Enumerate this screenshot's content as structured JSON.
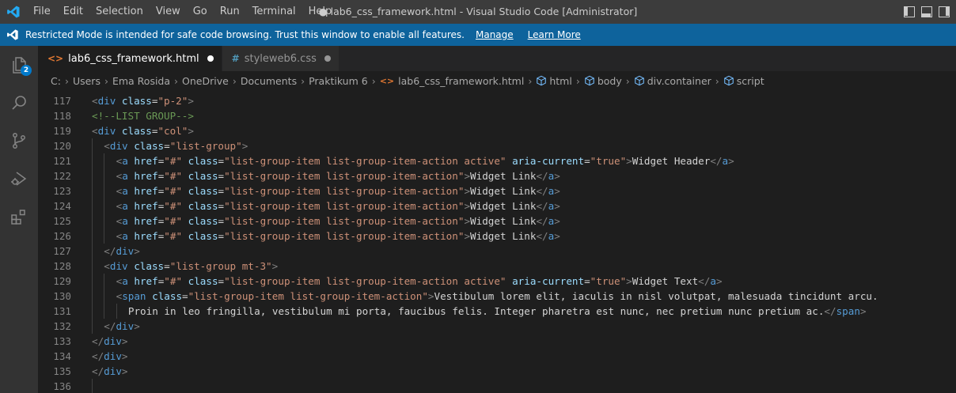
{
  "app": {
    "menu": [
      "File",
      "Edit",
      "Selection",
      "View",
      "Go",
      "Run",
      "Terminal",
      "Help"
    ],
    "window_title": "● lab6_css_framework.html - Visual Studio Code [Administrator]",
    "accent": "#007acc"
  },
  "banner": {
    "message": "Restricted Mode is intended for safe code browsing. Trust this window to enable all features.",
    "manage": "Manage",
    "learn_more": "Learn More",
    "color": "#0e639c"
  },
  "activity": {
    "explorer_badge": "2",
    "icons": [
      "files-icon",
      "search-icon",
      "source-control-icon",
      "run-debug-icon",
      "extensions-icon"
    ]
  },
  "tabs": [
    {
      "label": "lab6_css_framework.html",
      "icon": "<>",
      "active": true
    },
    {
      "label": "styleweb6.css",
      "icon": "#",
      "active": false
    }
  ],
  "breadcrumb": [
    "C:",
    "Users",
    "Ema Rosida",
    "OneDrive",
    "Documents",
    "Praktikum 6",
    "lab6_css_framework.html",
    "html",
    "body",
    "div.container",
    "script"
  ],
  "editor": {
    "lines": [
      {
        "n": "117",
        "indent": 0,
        "tokens": [
          [
            "t",
            "<"
          ],
          [
            "tg",
            "div"
          ],
          [
            "at",
            " class"
          ],
          [
            "tx",
            "="
          ],
          [
            "st",
            "\"p-2\""
          ],
          [
            "t",
            ">"
          ]
        ]
      },
      {
        "n": "118",
        "indent": 0,
        "tokens": [
          [
            "cm",
            "<!--LIST GROUP-->"
          ]
        ]
      },
      {
        "n": "119",
        "indent": 0,
        "tokens": [
          [
            "t",
            "<"
          ],
          [
            "tg",
            "div"
          ],
          [
            "at",
            " class"
          ],
          [
            "tx",
            "="
          ],
          [
            "st",
            "\"col\""
          ],
          [
            "t",
            ">"
          ]
        ]
      },
      {
        "n": "120",
        "indent": 1,
        "tokens": [
          [
            "t",
            "<"
          ],
          [
            "tg",
            "div"
          ],
          [
            "at",
            " class"
          ],
          [
            "tx",
            "="
          ],
          [
            "st",
            "\"list-group\""
          ],
          [
            "t",
            ">"
          ]
        ]
      },
      {
        "n": "121",
        "indent": 2,
        "tokens": [
          [
            "t",
            "<"
          ],
          [
            "tg",
            "a"
          ],
          [
            "at",
            " href"
          ],
          [
            "tx",
            "="
          ],
          [
            "st",
            "\"#\""
          ],
          [
            "at",
            " class"
          ],
          [
            "tx",
            "="
          ],
          [
            "st",
            "\"list-group-item list-group-item-action active\""
          ],
          [
            "at",
            " aria-current"
          ],
          [
            "tx",
            "="
          ],
          [
            "st",
            "\"true\""
          ],
          [
            "t",
            ">"
          ],
          [
            "tx",
            "Widget Header"
          ],
          [
            "t",
            "</"
          ],
          [
            "tg",
            "a"
          ],
          [
            "t",
            ">"
          ]
        ]
      },
      {
        "n": "122",
        "indent": 2,
        "tokens": [
          [
            "t",
            "<"
          ],
          [
            "tg",
            "a"
          ],
          [
            "at",
            " href"
          ],
          [
            "tx",
            "="
          ],
          [
            "st",
            "\"#\""
          ],
          [
            "at",
            " class"
          ],
          [
            "tx",
            "="
          ],
          [
            "st",
            "\"list-group-item list-group-item-action\""
          ],
          [
            "t",
            ">"
          ],
          [
            "tx",
            "Widget Link"
          ],
          [
            "t",
            "</"
          ],
          [
            "tg",
            "a"
          ],
          [
            "t",
            ">"
          ]
        ]
      },
      {
        "n": "123",
        "indent": 2,
        "tokens": [
          [
            "t",
            "<"
          ],
          [
            "tg",
            "a"
          ],
          [
            "at",
            " href"
          ],
          [
            "tx",
            "="
          ],
          [
            "st",
            "\"#\""
          ],
          [
            "at",
            " class"
          ],
          [
            "tx",
            "="
          ],
          [
            "st",
            "\"list-group-item list-group-item-action\""
          ],
          [
            "t",
            ">"
          ],
          [
            "tx",
            "Widget Link"
          ],
          [
            "t",
            "</"
          ],
          [
            "tg",
            "a"
          ],
          [
            "t",
            ">"
          ]
        ]
      },
      {
        "n": "124",
        "indent": 2,
        "tokens": [
          [
            "t",
            "<"
          ],
          [
            "tg",
            "a"
          ],
          [
            "at",
            " href"
          ],
          [
            "tx",
            "="
          ],
          [
            "st",
            "\"#\""
          ],
          [
            "at",
            " class"
          ],
          [
            "tx",
            "="
          ],
          [
            "st",
            "\"list-group-item list-group-item-action\""
          ],
          [
            "t",
            ">"
          ],
          [
            "tx",
            "Widget Link"
          ],
          [
            "t",
            "</"
          ],
          [
            "tg",
            "a"
          ],
          [
            "t",
            ">"
          ]
        ]
      },
      {
        "n": "125",
        "indent": 2,
        "tokens": [
          [
            "t",
            "<"
          ],
          [
            "tg",
            "a"
          ],
          [
            "at",
            " href"
          ],
          [
            "tx",
            "="
          ],
          [
            "st",
            "\"#\""
          ],
          [
            "at",
            " class"
          ],
          [
            "tx",
            "="
          ],
          [
            "st",
            "\"list-group-item list-group-item-action\""
          ],
          [
            "t",
            ">"
          ],
          [
            "tx",
            "Widget Link"
          ],
          [
            "t",
            "</"
          ],
          [
            "tg",
            "a"
          ],
          [
            "t",
            ">"
          ]
        ]
      },
      {
        "n": "126",
        "indent": 2,
        "tokens": [
          [
            "t",
            "<"
          ],
          [
            "tg",
            "a"
          ],
          [
            "at",
            " href"
          ],
          [
            "tx",
            "="
          ],
          [
            "st",
            "\"#\""
          ],
          [
            "at",
            " class"
          ],
          [
            "tx",
            "="
          ],
          [
            "st",
            "\"list-group-item list-group-item-action\""
          ],
          [
            "t",
            ">"
          ],
          [
            "tx",
            "Widget Link"
          ],
          [
            "t",
            "</"
          ],
          [
            "tg",
            "a"
          ],
          [
            "t",
            ">"
          ]
        ]
      },
      {
        "n": "127",
        "indent": 1,
        "tokens": [
          [
            "t",
            "</"
          ],
          [
            "tg",
            "div"
          ],
          [
            "t",
            ">"
          ]
        ]
      },
      {
        "n": "128",
        "indent": 1,
        "tokens": [
          [
            "t",
            "<"
          ],
          [
            "tg",
            "div"
          ],
          [
            "at",
            " class"
          ],
          [
            "tx",
            "="
          ],
          [
            "st",
            "\"list-group mt-3\""
          ],
          [
            "t",
            ">"
          ]
        ]
      },
      {
        "n": "129",
        "indent": 2,
        "tokens": [
          [
            "t",
            "<"
          ],
          [
            "tg",
            "a"
          ],
          [
            "at",
            " href"
          ],
          [
            "tx",
            "="
          ],
          [
            "st",
            "\"#\""
          ],
          [
            "at",
            " class"
          ],
          [
            "tx",
            "="
          ],
          [
            "st",
            "\"list-group-item list-group-item-action active\""
          ],
          [
            "at",
            " aria-current"
          ],
          [
            "tx",
            "="
          ],
          [
            "st",
            "\"true\""
          ],
          [
            "t",
            ">"
          ],
          [
            "tx",
            "Widget Text"
          ],
          [
            "t",
            "</"
          ],
          [
            "tg",
            "a"
          ],
          [
            "t",
            ">"
          ]
        ]
      },
      {
        "n": "130",
        "indent": 2,
        "tokens": [
          [
            "t",
            "<"
          ],
          [
            "tg",
            "span"
          ],
          [
            "at",
            " class"
          ],
          [
            "tx",
            "="
          ],
          [
            "st",
            "\"list-group-item list-group-item-action\""
          ],
          [
            "t",
            ">"
          ],
          [
            "tx",
            "Vestibulum lorem elit, iaculis in nisl volutpat, malesuada tincidunt arcu."
          ]
        ]
      },
      {
        "n": "131",
        "indent": 3,
        "tokens": [
          [
            "tx",
            "Proin in leo fringilla, vestibulum mi porta, faucibus felis. Integer pharetra est nunc, nec pretium nunc pretium ac."
          ],
          [
            "t",
            "</"
          ],
          [
            "tg",
            "span"
          ],
          [
            "t",
            ">"
          ]
        ]
      },
      {
        "n": "132",
        "indent": 1,
        "tokens": [
          [
            "t",
            "</"
          ],
          [
            "tg",
            "div"
          ],
          [
            "t",
            ">"
          ]
        ]
      },
      {
        "n": "133",
        "indent": 0,
        "tokens": [
          [
            "t",
            "</"
          ],
          [
            "tg",
            "div"
          ],
          [
            "t",
            ">"
          ]
        ]
      },
      {
        "n": "134",
        "indent": 0,
        "tokens": [
          [
            "t",
            "</"
          ],
          [
            "tg",
            "div"
          ],
          [
            "t",
            ">"
          ]
        ]
      },
      {
        "n": "135",
        "indent": 0,
        "tokens": [
          [
            "t",
            "</"
          ],
          [
            "tg",
            "div"
          ],
          [
            "t",
            ">"
          ]
        ]
      },
      {
        "n": "136",
        "indent": 0,
        "tokens": []
      }
    ]
  }
}
